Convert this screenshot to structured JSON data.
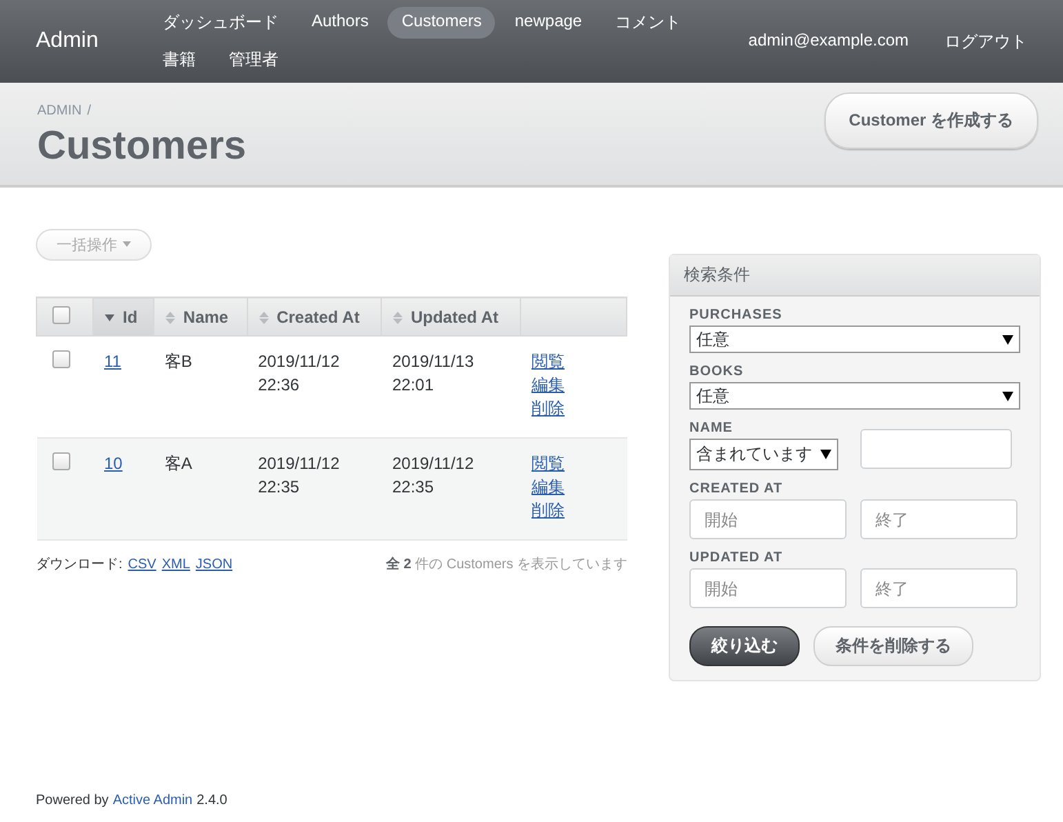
{
  "header": {
    "site_title": "Admin",
    "nav": [
      {
        "label": "ダッシュボード",
        "selected": false
      },
      {
        "label": "Authors",
        "selected": false
      },
      {
        "label": "Customers",
        "selected": true
      },
      {
        "label": "newpage",
        "selected": false
      },
      {
        "label": "コメント",
        "selected": false
      },
      {
        "label": "書籍",
        "selected": false
      },
      {
        "label": "管理者",
        "selected": false
      }
    ],
    "utility": [
      "admin@example.com",
      "ログアウト"
    ]
  },
  "title_bar": {
    "breadcrumb": [
      "ADMIN",
      "/"
    ],
    "title": "Customers",
    "action": "Customer を作成する"
  },
  "batch_actions": {
    "label": "一括操作",
    "disabled": true
  },
  "table": {
    "columns": [
      {
        "label": "Id",
        "sorted": true
      },
      {
        "label": "Name",
        "sorted": false
      },
      {
        "label": "Created At",
        "sorted": false
      },
      {
        "label": "Updated At",
        "sorted": false
      }
    ],
    "select_all": {
      "checked": false
    },
    "rows": [
      {
        "checked": false,
        "id": "11",
        "name": "客B",
        "created": [
          "2019/11/12",
          "22:36"
        ],
        "updated": [
          "2019/11/13",
          "22:01"
        ],
        "actions": [
          "閲覧",
          "編集",
          "削除"
        ]
      },
      {
        "checked": false,
        "id": "10",
        "name": "客A",
        "created": [
          "2019/11/12",
          "22:35"
        ],
        "updated": [
          "2019/11/12",
          "22:35"
        ],
        "actions": [
          "閲覧",
          "編集",
          "削除"
        ]
      }
    ]
  },
  "download": {
    "label": "ダウンロード:",
    "formats": [
      "CSV",
      "XML",
      "JSON"
    ]
  },
  "count": "**全 2** 件の Customers を表示しています",
  "sidebar": {
    "title": "検索条件",
    "filters": [
      {
        "kind": "select",
        "label": "PURCHASES",
        "value": "任意"
      },
      {
        "kind": "select",
        "label": "BOOKS",
        "value": "任意"
      },
      {
        "kind": "string",
        "label": "NAME",
        "value": "含まれています"
      },
      {
        "kind": "range",
        "label": "CREATED AT",
        "from": {
          "placeholder": "開始"
        },
        "to": {
          "placeholder": "終了"
        }
      },
      {
        "kind": "range",
        "label": "UPDATED AT",
        "from": {
          "placeholder": "開始"
        },
        "to": {
          "placeholder": "終了"
        }
      }
    ],
    "buttons": [
      "絞り込む",
      "条件を削除する"
    ]
  },
  "footer": {
    "prefix": "Powered by",
    "link": "Active Admin",
    "version": "2.4.0"
  }
}
